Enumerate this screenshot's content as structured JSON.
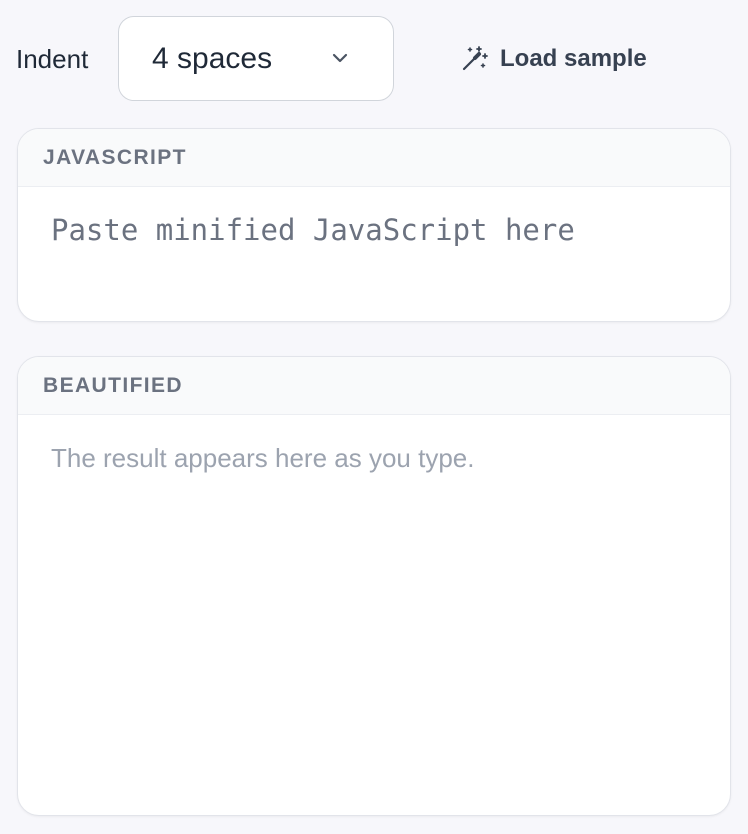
{
  "toolbar": {
    "indent_label": "Indent",
    "indent_value": "4 spaces",
    "load_sample_label": "Load sample"
  },
  "input_panel": {
    "title": "JAVASCRIPT",
    "placeholder": "Paste minified JavaScript here",
    "value": ""
  },
  "output_panel": {
    "title": "BEAUTIFIED",
    "placeholder_text": "The result appears here as you type."
  },
  "icons": {
    "indent_dropdown": "chevron-down-icon",
    "load_sample": "magic-wand-icon"
  },
  "colors": {
    "page_background": "#f7f7fb",
    "panel_header_text": "#6b7280",
    "placeholder_text": "#9ca3af",
    "border": "#e2e4ea"
  }
}
